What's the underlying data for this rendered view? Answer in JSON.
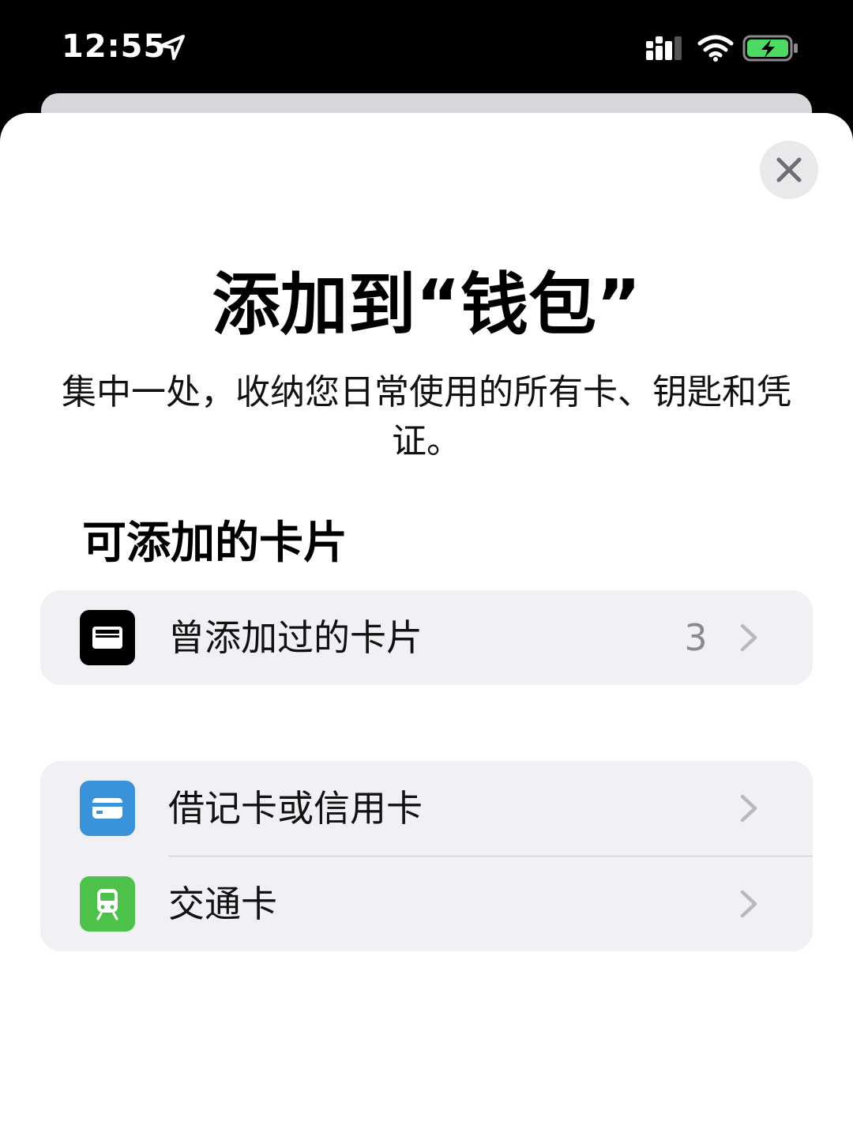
{
  "status_bar": {
    "time": "12:55"
  },
  "sheet": {
    "title": "添加到“钱包”",
    "subtitle": "集中一处，收纳您日常使用的所有卡、钥匙和凭证。",
    "section_heading": "可添加的卡片"
  },
  "groups": [
    {
      "rows": [
        {
          "label": "曾添加过的卡片",
          "count": "3",
          "icon": "wallet-icon",
          "icon_color": "#000000"
        }
      ]
    },
    {
      "rows": [
        {
          "label": "借记卡或信用卡",
          "icon": "credit-card-icon",
          "icon_color": "#3a93d8"
        },
        {
          "label": "交通卡",
          "icon": "train-icon",
          "icon_color": "#4cc24a"
        }
      ]
    }
  ],
  "colors": {
    "sheet_background": "#ffffff",
    "group_background": "#f1f1f5",
    "secondary_text": "#8a8a8e",
    "battery_charging": "#4cd964"
  }
}
